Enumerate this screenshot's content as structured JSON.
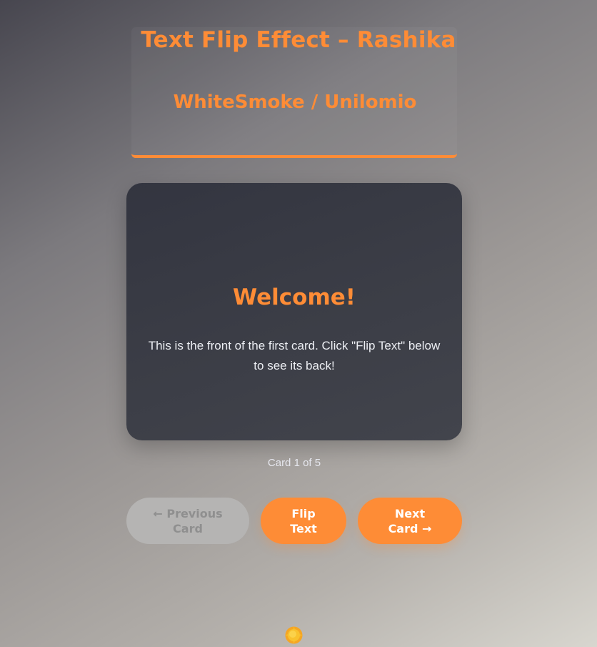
{
  "header": {
    "title": "Text Flip Effect – Rashika",
    "subtitle": "WhiteSmoke / Unilomio"
  },
  "card": {
    "title": "Welcome!",
    "body": "This is the front of the first card. Click \"Flip Text\" below to see its back!"
  },
  "counter": "Card 1 of 5",
  "buttons": {
    "previous": "← Previous\nCard",
    "flip": "Flip\nText",
    "next": "Next\nCard →"
  },
  "theme_toggle_icon": "sun-icon",
  "colors": {
    "accent": "#fe8c36",
    "card_bg": "#3b3d46",
    "disabled_button": "#b5b4b3"
  }
}
